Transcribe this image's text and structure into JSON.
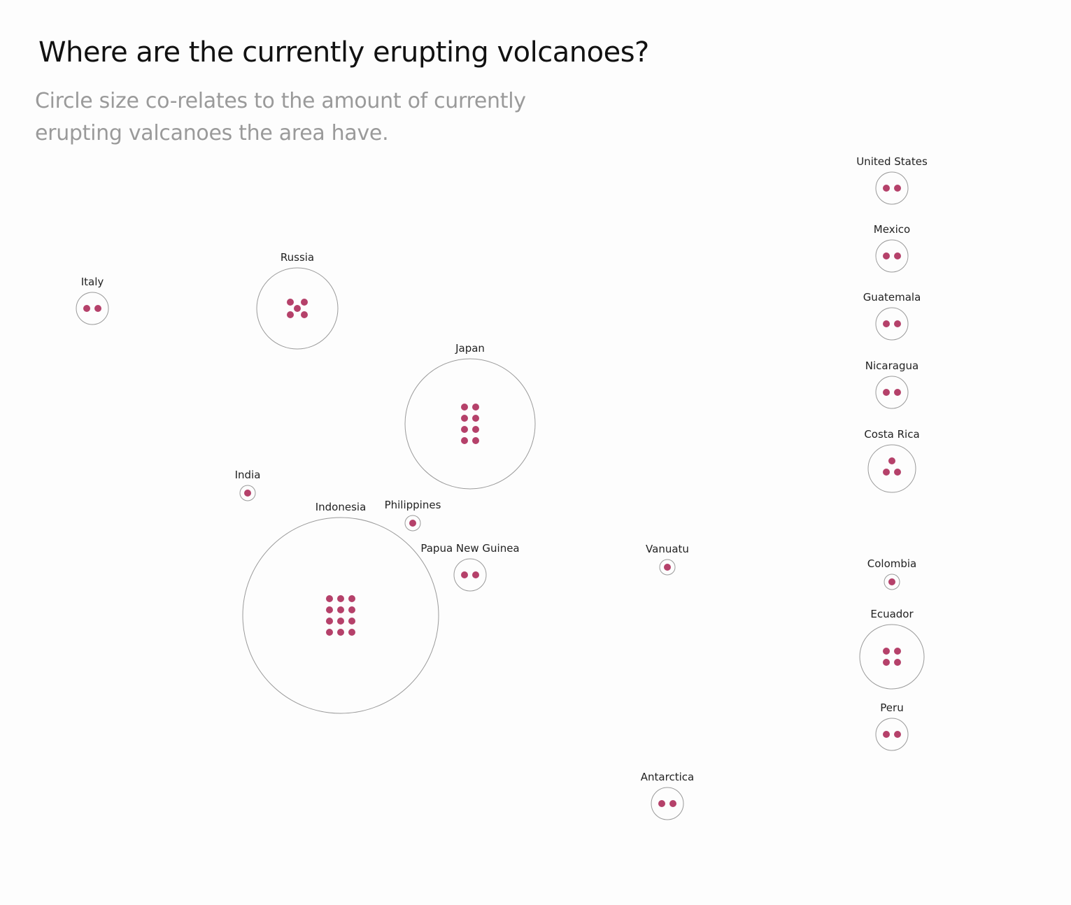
{
  "title": "Where are the currently erupting volcanoes?",
  "subtitle": "Circle size co-relates to the amount of currently erupting valcanoes the area have.",
  "colors": {
    "dot": "#b5416a",
    "circle_stroke": "#9a9a9a",
    "background": "#fdfdfd"
  },
  "chart_data": {
    "type": "bubble",
    "series": [
      {
        "country": "United States",
        "count": 2
      },
      {
        "country": "Mexico",
        "count": 2
      },
      {
        "country": "Guatemala",
        "count": 2
      },
      {
        "country": "Nicaragua",
        "count": 2
      },
      {
        "country": "Costa Rica",
        "count": 3
      },
      {
        "country": "Italy",
        "count": 2
      },
      {
        "country": "Russia",
        "count": 5
      },
      {
        "country": "Japan",
        "count": 8
      },
      {
        "country": "India",
        "count": 1
      },
      {
        "country": "Indonesia",
        "count": 12
      },
      {
        "country": "Philippines",
        "count": 1
      },
      {
        "country": "Papua New Guinea",
        "count": 2
      },
      {
        "country": "Vanuatu",
        "count": 1
      },
      {
        "country": "Colombia",
        "count": 1
      },
      {
        "country": "Ecuador",
        "count": 4
      },
      {
        "country": "Peru",
        "count": 2
      },
      {
        "country": "Antarctica",
        "count": 2
      }
    ]
  }
}
